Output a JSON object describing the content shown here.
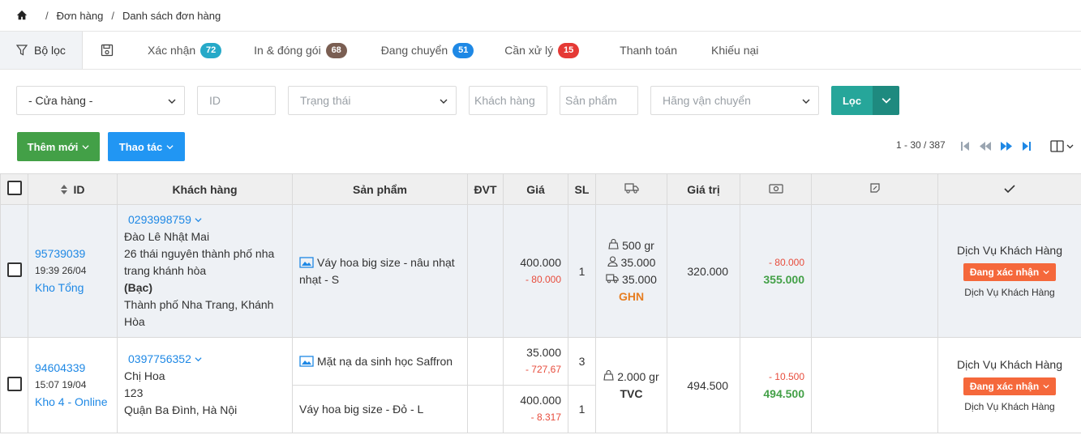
{
  "breadcrumb": {
    "items": [
      "Đơn hàng",
      "Danh sách đơn hàng"
    ],
    "separator": "/"
  },
  "tabs": [
    {
      "label": "Bộ lọc",
      "icon": "filter-icon"
    },
    {
      "label": "",
      "icon": "save-icon"
    },
    {
      "label": "Xác nhận",
      "badge": "72",
      "badge_color": "#26a9c8"
    },
    {
      "label": "In & đóng gói",
      "badge": "68",
      "badge_color": "#7a5e52"
    },
    {
      "label": "Đang chuyển",
      "badge": "51",
      "badge_color": "#1e88e5"
    },
    {
      "label": "Cần xử lý",
      "badge": "15",
      "badge_color": "#e53935"
    },
    {
      "label": "Thanh toán"
    },
    {
      "label": "Khiếu nại"
    }
  ],
  "filters": {
    "store": "- Cửa hàng -",
    "id_placeholder": "ID",
    "status_placeholder": "Trạng thái",
    "customer_placeholder": "Khách hàng",
    "product_placeholder": "Sản phẩm",
    "carrier_placeholder": "Hãng vận chuyển",
    "filter_button": "Lọc"
  },
  "actions": {
    "add_new": "Thêm mới",
    "actions": "Thao tác"
  },
  "pagination": {
    "range": "1 - 30 / 387"
  },
  "table": {
    "headers": {
      "id": "ID",
      "customer": "Khách hàng",
      "product": "Sản phẩm",
      "unit": "ĐVT",
      "price": "Giá",
      "qty": "SL",
      "value": "Giá trị"
    },
    "rows": [
      {
        "id": "95739039",
        "time": "19:39 26/04",
        "warehouse": "Kho Tổng",
        "phone": "0293998759",
        "customer_lines": [
          "Đào Lê Nhật Mai",
          "26 thái nguyên thành phố nha",
          "trang khánh hòa",
          "(Bạc)",
          "Thành phố Nha Trang, Khánh",
          "Hòa"
        ],
        "items": [
          {
            "name": "Váy hoa big size - nâu nhạt",
            "name2": "nhạt - S",
            "price": "400.000",
            "discount": "- 80.000",
            "qty": "1"
          }
        ],
        "weight": "500 gr",
        "shipping_customer": "35.000",
        "shipping_fee": "35.000",
        "carrier": "GHN",
        "value": "320.000",
        "money_discount": "- 80.000",
        "money_total": "355.000",
        "assignee": "Dịch Vụ Khách Hàng",
        "status": "Đang xác nhận",
        "assignee2": "Dịch Vụ Khách Hàng"
      },
      {
        "id": "94604339",
        "time": "15:07 19/04",
        "warehouse": "Kho 4 - Online",
        "phone": "0397756352",
        "customer_lines": [
          "Chị Hoa",
          "123",
          "Quận Ba Đình, Hà Nội"
        ],
        "items": [
          {
            "name": "Mặt nạ da sinh học Saffron",
            "price": "35.000",
            "discount": "- 727,67",
            "qty": "3"
          },
          {
            "name": "Váy hoa big size - Đỏ - L",
            "price": "400.000",
            "discount": "- 8.317",
            "qty": "1"
          }
        ],
        "weight": "2.000 gr",
        "carrier": "TVC",
        "value": "494.500",
        "money_discount": "- 10.500",
        "money_total": "494.500",
        "assignee": "Dịch Vụ Khách Hàng",
        "status": "Đang xác nhận",
        "assignee2": "Dịch Vụ Khách Hàng"
      }
    ]
  },
  "colors": {
    "primary": "#1e88e5",
    "success": "#43a047",
    "teal": "#26a69a",
    "orange_status": "#f5683b",
    "red": "#e74c3c"
  }
}
